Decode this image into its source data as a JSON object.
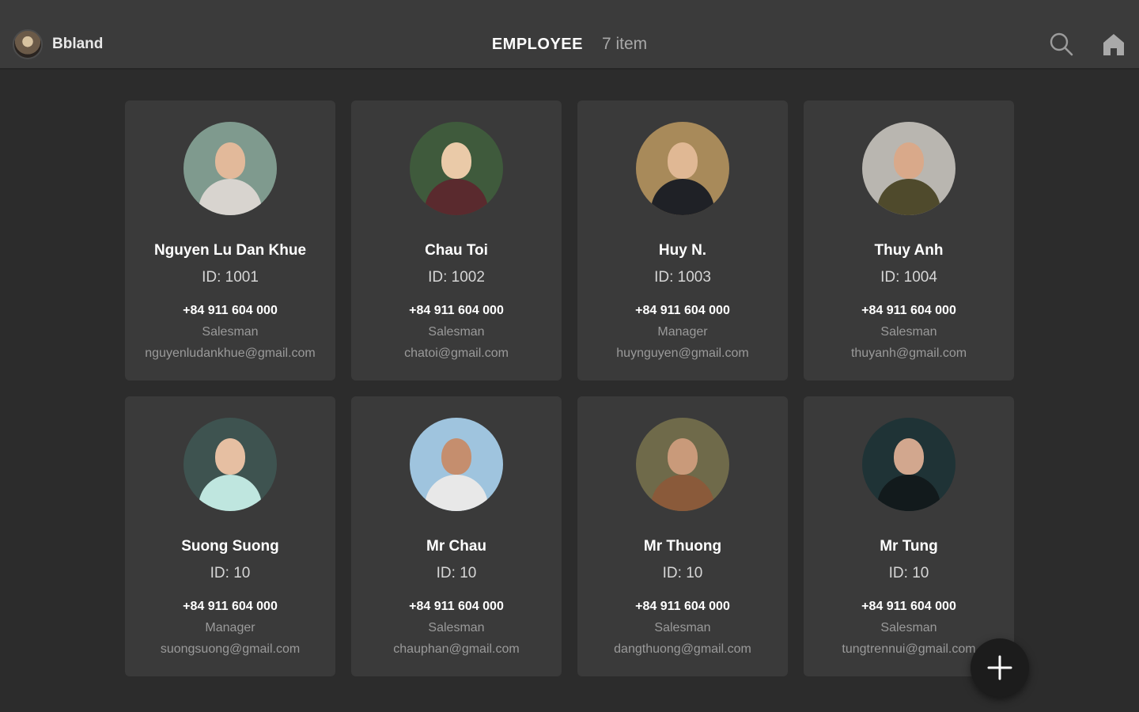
{
  "header": {
    "brand_name": "Bbland",
    "title": "EMPLOYEE",
    "count": "7 item",
    "icons": [
      "search-icon",
      "home-icon"
    ]
  },
  "employees": [
    {
      "name": "Nguyen Lu Dan Khue",
      "id": "ID: 1001",
      "phone": "+84 911 604 000",
      "role": "Salesman",
      "email": "nguyenludankhue@gmail.com",
      "avatar": {
        "bg": "#7f9a8e",
        "skin": "#e2b99a",
        "outfit": "#d8d4cf"
      }
    },
    {
      "name": "Chau Toi",
      "id": "ID: 1002",
      "phone": "+84 911 604 000",
      "role": "Salesman",
      "email": "chatoi@gmail.com",
      "avatar": {
        "bg": "#3f5a3c",
        "skin": "#eacaa8",
        "outfit": "#5a2a2e"
      }
    },
    {
      "name": "Huy N.",
      "id": "ID: 1003",
      "phone": "+84 911 604 000",
      "role": "Manager",
      "email": "huynguyen@gmail.com",
      "avatar": {
        "bg": "#a88a5a",
        "skin": "#e0b894",
        "outfit": "#1f2126"
      }
    },
    {
      "name": "Thuy Anh",
      "id": "ID: 1004",
      "phone": "+84 911 604 000",
      "role": "Salesman",
      "email": "thuyanh@gmail.com",
      "avatar": {
        "bg": "#b9b6b0",
        "skin": "#d9a98a",
        "outfit": "#4f4a2c"
      }
    },
    {
      "name": "Suong Suong",
      "id": "ID: 10",
      "phone": "+84 911 604 000",
      "role": "Manager",
      "email": "suongsuong@gmail.com",
      "avatar": {
        "bg": "#3e5350",
        "skin": "#e6bfa2",
        "outfit": "#bfe6df"
      }
    },
    {
      "name": "Mr Chau",
      "id": "ID: 10",
      "phone": "+84 911 604 000",
      "role": "Salesman",
      "email": "chauphan@gmail.com",
      "avatar": {
        "bg": "#9fc4de",
        "skin": "#c58e6e",
        "outfit": "#e8e8e8"
      }
    },
    {
      "name": "Mr Thuong",
      "id": "ID: 10",
      "phone": "+84 911 604 000",
      "role": "Salesman",
      "email": "dangthuong@gmail.com",
      "avatar": {
        "bg": "#6f6a4a",
        "skin": "#c99a7a",
        "outfit": "#8a5a3a"
      }
    },
    {
      "name": "Mr Tung",
      "id": "ID: 10",
      "phone": "+84 911 604 000",
      "role": "Salesman",
      "email": "tungtrennui@gmail.com",
      "avatar": {
        "bg": "#1f3336",
        "skin": "#d2a78e",
        "outfit": "#121a1c"
      }
    }
  ],
  "fab": {
    "icon": "plus-icon"
  }
}
